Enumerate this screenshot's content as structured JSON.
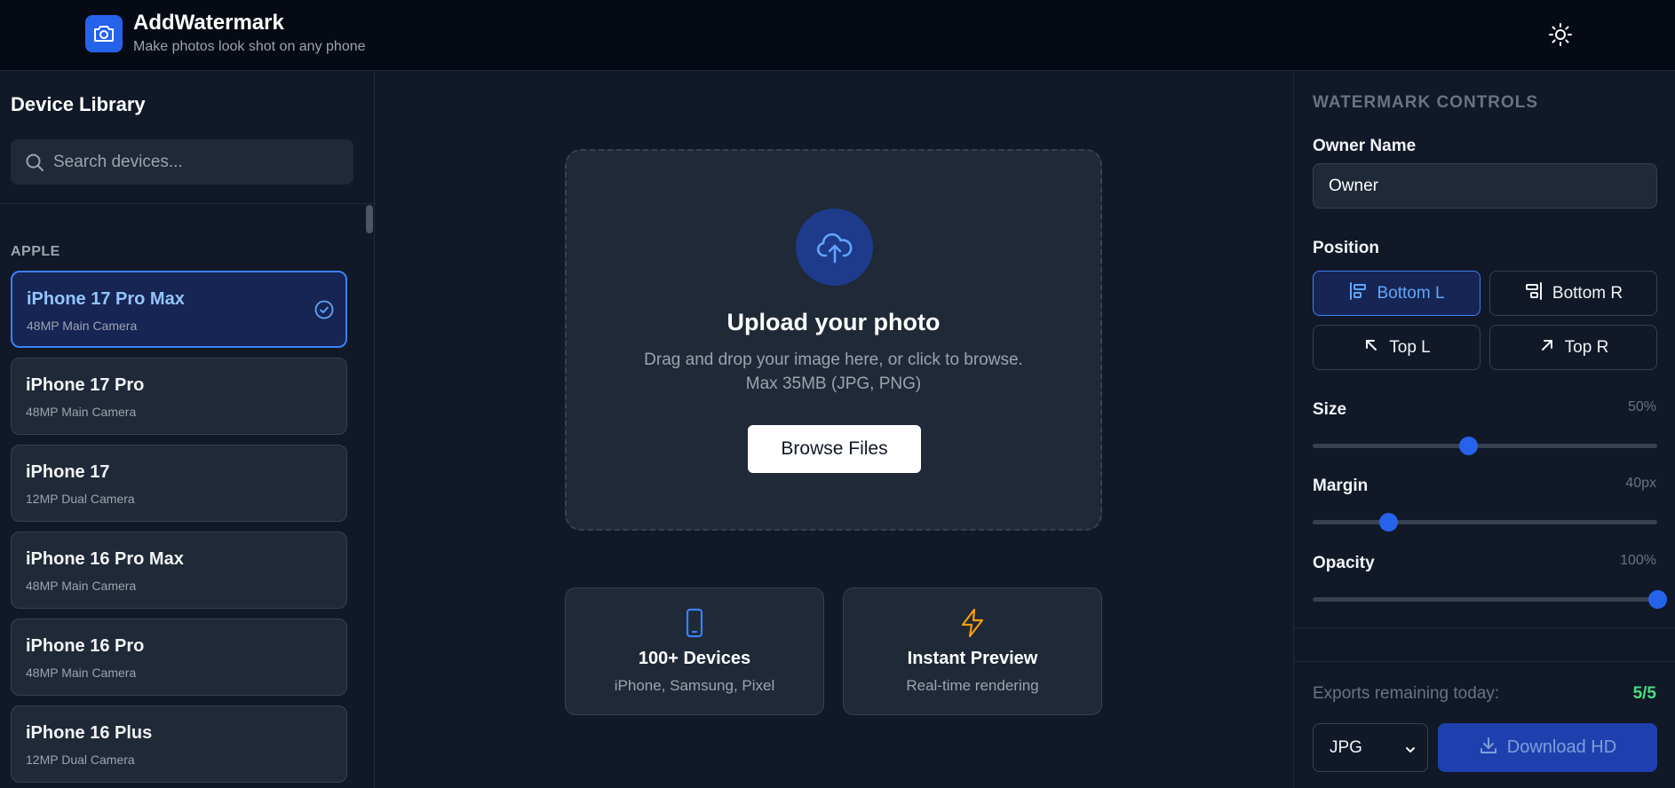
{
  "app": {
    "title": "AddWatermark",
    "subtitle": "Make photos look shot on any phone",
    "logo_icon": "camera-icon",
    "theme_icon": "sun-icon"
  },
  "sidebar": {
    "title": "Device Library",
    "search_placeholder": "Search devices...",
    "group_label": "APPLE",
    "devices": [
      {
        "name": "iPhone 17 Pro Max",
        "spec": "48MP Main Camera",
        "selected": true
      },
      {
        "name": "iPhone 17 Pro",
        "spec": "48MP Main Camera",
        "selected": false
      },
      {
        "name": "iPhone 17",
        "spec": "12MP Dual Camera",
        "selected": false
      },
      {
        "name": "iPhone 16 Pro Max",
        "spec": "48MP Main Camera",
        "selected": false
      },
      {
        "name": "iPhone 16 Pro",
        "spec": "48MP Main Camera",
        "selected": false
      },
      {
        "name": "iPhone 16 Plus",
        "spec": "12MP Dual Camera",
        "selected": false
      }
    ]
  },
  "upload": {
    "title": "Upload your photo",
    "desc_line1": "Drag and drop your image here, or click to browse.",
    "desc_line2": "Max 35MB (JPG, PNG)",
    "browse_label": "Browse Files",
    "icon": "cloud-upload-icon"
  },
  "features": [
    {
      "title": "100+ Devices",
      "subtitle": "iPhone, Samsung, Pixel",
      "icon": "smartphone-icon",
      "color": "#3b82f6"
    },
    {
      "title": "Instant Preview",
      "subtitle": "Real-time rendering",
      "icon": "lightning-icon",
      "color": "#f59e0b"
    }
  ],
  "controls": {
    "heading": "WATERMARK CONTROLS",
    "owner_label": "Owner Name",
    "owner_value": "Owner",
    "position_label": "Position",
    "positions": [
      {
        "label": "Bottom L",
        "active": true
      },
      {
        "label": "Bottom R",
        "active": false
      },
      {
        "label": "Top L",
        "active": false
      },
      {
        "label": "Top R",
        "active": false
      }
    ],
    "size": {
      "label": "Size",
      "value_text": "50%",
      "level": 0.45
    },
    "margin": {
      "label": "Margin",
      "value_text": "40px",
      "level": 0.22
    },
    "opacity": {
      "label": "Opacity",
      "value_text": "100%",
      "level": 1.0
    },
    "exports_label": "Exports remaining today:",
    "exports_count": "5/5",
    "format_value": "JPG",
    "download_label": "Download HD"
  },
  "colors": {
    "accent": "#2563eb",
    "success": "#4ade80",
    "background": "#111827"
  }
}
